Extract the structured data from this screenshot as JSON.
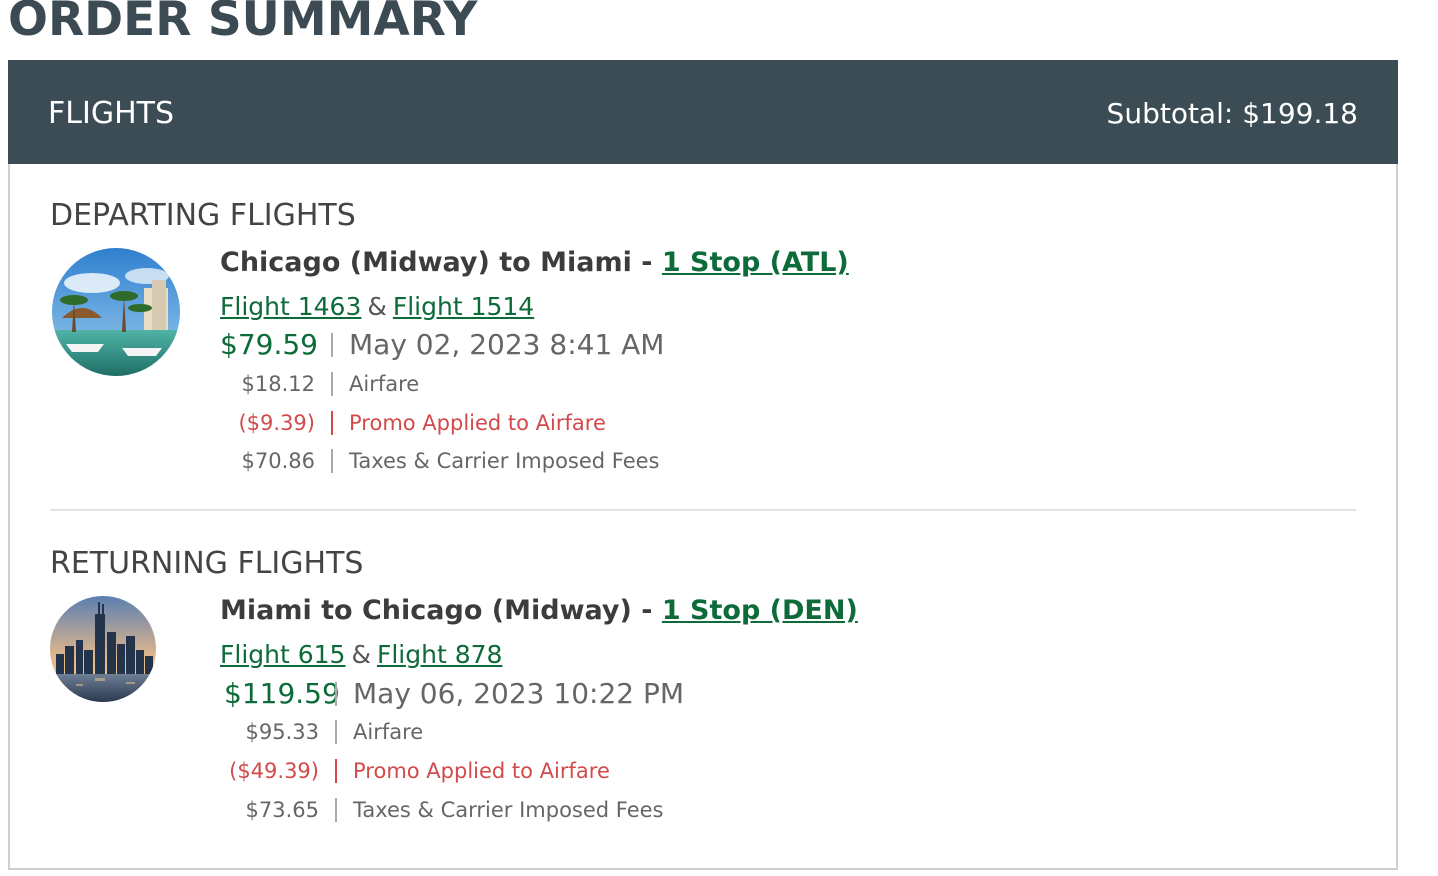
{
  "page": {
    "title": "ORDER SUMMARY"
  },
  "panel": {
    "title": "FLIGHTS",
    "subtotal": "Subtotal: $199.18"
  },
  "departing": {
    "section_title": "DEPARTING FLIGHTS",
    "route_text": "Chicago (Midway) to Miami - ",
    "stop_link": "1 Stop (ATL)",
    "flight_a": "Flight 1463",
    "amp": "&",
    "flight_b": "Flight 1514",
    "total": "$79.59",
    "datetime": "May 02, 2023 8:41 AM",
    "lines": [
      {
        "amount": "$18.12",
        "desc": "Airfare"
      },
      {
        "amount": "($9.39)",
        "desc": "Promo Applied to Airfare"
      },
      {
        "amount": "$70.86",
        "desc": "Taxes & Carrier Imposed Fees"
      }
    ],
    "photo": "miami-harbor-photo"
  },
  "returning": {
    "section_title": "RETURNING FLIGHTS",
    "route_text": "Miami to Chicago (Midway) - ",
    "stop_link": "1 Stop (DEN)",
    "flight_a": "Flight 615",
    "amp": "&",
    "flight_b": "Flight 878",
    "total": "$119.59",
    "datetime": "May 06, 2023 10:22 PM",
    "lines": [
      {
        "amount": "$95.33",
        "desc": "Airfare"
      },
      {
        "amount": "($49.39)",
        "desc": "Promo Applied to Airfare"
      },
      {
        "amount": "$73.65",
        "desc": "Taxes & Carrier Imposed Fees"
      }
    ],
    "photo": "chicago-skyline-photo"
  },
  "colors": {
    "header_bg": "#3c4c55",
    "title": "#3c4a53",
    "link_green": "#0d6b3a",
    "promo_red": "#d24a4a"
  }
}
